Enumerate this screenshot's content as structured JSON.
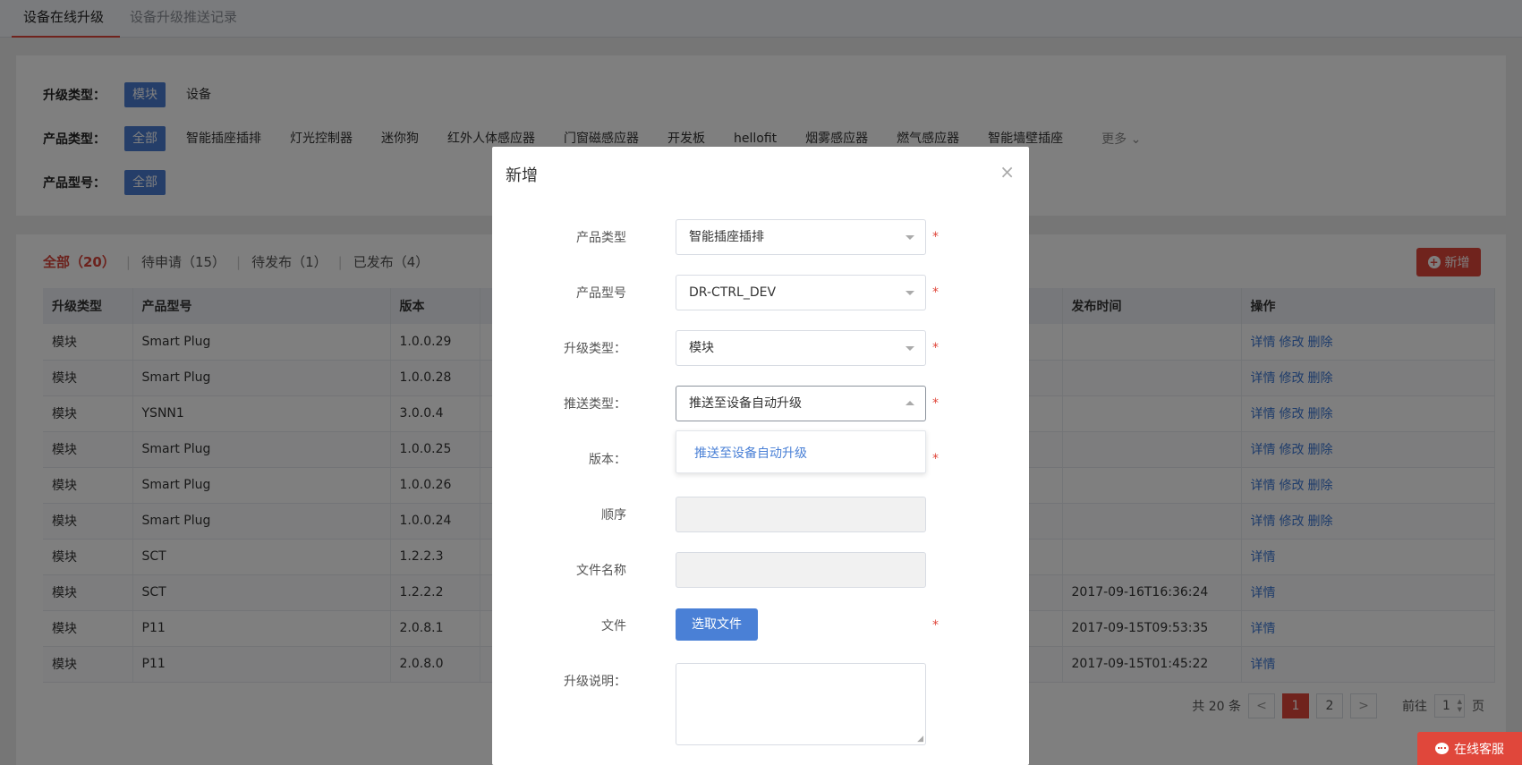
{
  "top_tabs": [
    {
      "label": "设备在线升级"
    },
    {
      "label": "设备升级推送记录"
    }
  ],
  "filters": {
    "upgrade_type": {
      "label": "升级类型：",
      "options": [
        "模块",
        "设备"
      ]
    },
    "product_type": {
      "label": "产品类型：",
      "options": [
        "全部",
        "智能插座插排",
        "灯光控制器",
        "迷你狗",
        "红外人体感应器",
        "门窗磁感应器",
        "开发板",
        "hellofit",
        "烟雾感应器",
        "燃气感应器",
        "智能墙壁插座"
      ],
      "more": "更多"
    },
    "product_model": {
      "label": "产品型号：",
      "options": [
        "全部"
      ]
    }
  },
  "status_tabs": [
    "全部（20）",
    "待申请（15）",
    "待发布（1）",
    "已发布（4）"
  ],
  "add_button": "新增",
  "table": {
    "headers": [
      "升级类型",
      "产品型号",
      "版本",
      "",
      "发布时间",
      "操作"
    ],
    "rows": [
      {
        "type": "模块",
        "model": "Smart Plug",
        "version": "1.0.0.29",
        "time": "",
        "ops": [
          "详情",
          "修改",
          "删除"
        ]
      },
      {
        "type": "模块",
        "model": "Smart Plug",
        "version": "1.0.0.28",
        "time": "",
        "ops": [
          "详情",
          "修改",
          "删除"
        ]
      },
      {
        "type": "模块",
        "model": "YSNN1",
        "version": "3.0.0.4",
        "time": "",
        "ops": [
          "详情",
          "修改",
          "删除"
        ]
      },
      {
        "type": "模块",
        "model": "Smart Plug",
        "version": "1.0.0.25",
        "time": "",
        "ops": [
          "详情",
          "修改",
          "删除"
        ]
      },
      {
        "type": "模块",
        "model": "Smart Plug",
        "version": "1.0.0.26",
        "time": "",
        "ops": [
          "详情",
          "修改",
          "删除"
        ]
      },
      {
        "type": "模块",
        "model": "Smart Plug",
        "version": "1.0.0.24",
        "time": "",
        "ops": [
          "详情",
          "修改",
          "删除"
        ]
      },
      {
        "type": "模块",
        "model": "SCT",
        "version": "1.2.2.3",
        "time": "",
        "ops": [
          "详情"
        ]
      },
      {
        "type": "模块",
        "model": "SCT",
        "version": "1.2.2.2",
        "time": "2017-09-16T16:36:24",
        "ops": [
          "详情"
        ]
      },
      {
        "type": "模块",
        "model": "P11",
        "version": "2.0.8.1",
        "time": "2017-09-15T09:53:35",
        "ops": [
          "详情"
        ]
      },
      {
        "type": "模块",
        "model": "P11",
        "version": "2.0.8.0",
        "time": "2017-09-15T01:45:22",
        "ops": [
          "详情"
        ]
      }
    ]
  },
  "pager": {
    "total": "共 20 条",
    "pages": [
      "1",
      "2"
    ],
    "prev": "<",
    "next": ">",
    "goto_label": "前往",
    "goto_value": "1",
    "page_suffix": "页"
  },
  "modal": {
    "title": "新增",
    "close": "×",
    "fields": {
      "product_type": {
        "label": "产品类型",
        "value": "智能插座插排"
      },
      "product_model": {
        "label": "产品型号",
        "value": "DR-CTRL_DEV"
      },
      "upgrade_type": {
        "label": "升级类型：",
        "value": "模块"
      },
      "push_type": {
        "label": "推送类型：",
        "value": "推送至设备自动升级"
      },
      "version": {
        "label": "版本："
      },
      "order": {
        "label": "顺序"
      },
      "file_name": {
        "label": "文件名称"
      },
      "file": {
        "label": "文件",
        "button": "选取文件"
      },
      "description": {
        "label": "升级说明："
      }
    },
    "dropdown_option": "推送至设备自动升级",
    "required_mark": "*"
  },
  "chat_button": "在线客服",
  "colors": {
    "accent_red": "#e0473b",
    "accent_blue": "#4a7cd2",
    "link_blue": "#3d78d6"
  }
}
